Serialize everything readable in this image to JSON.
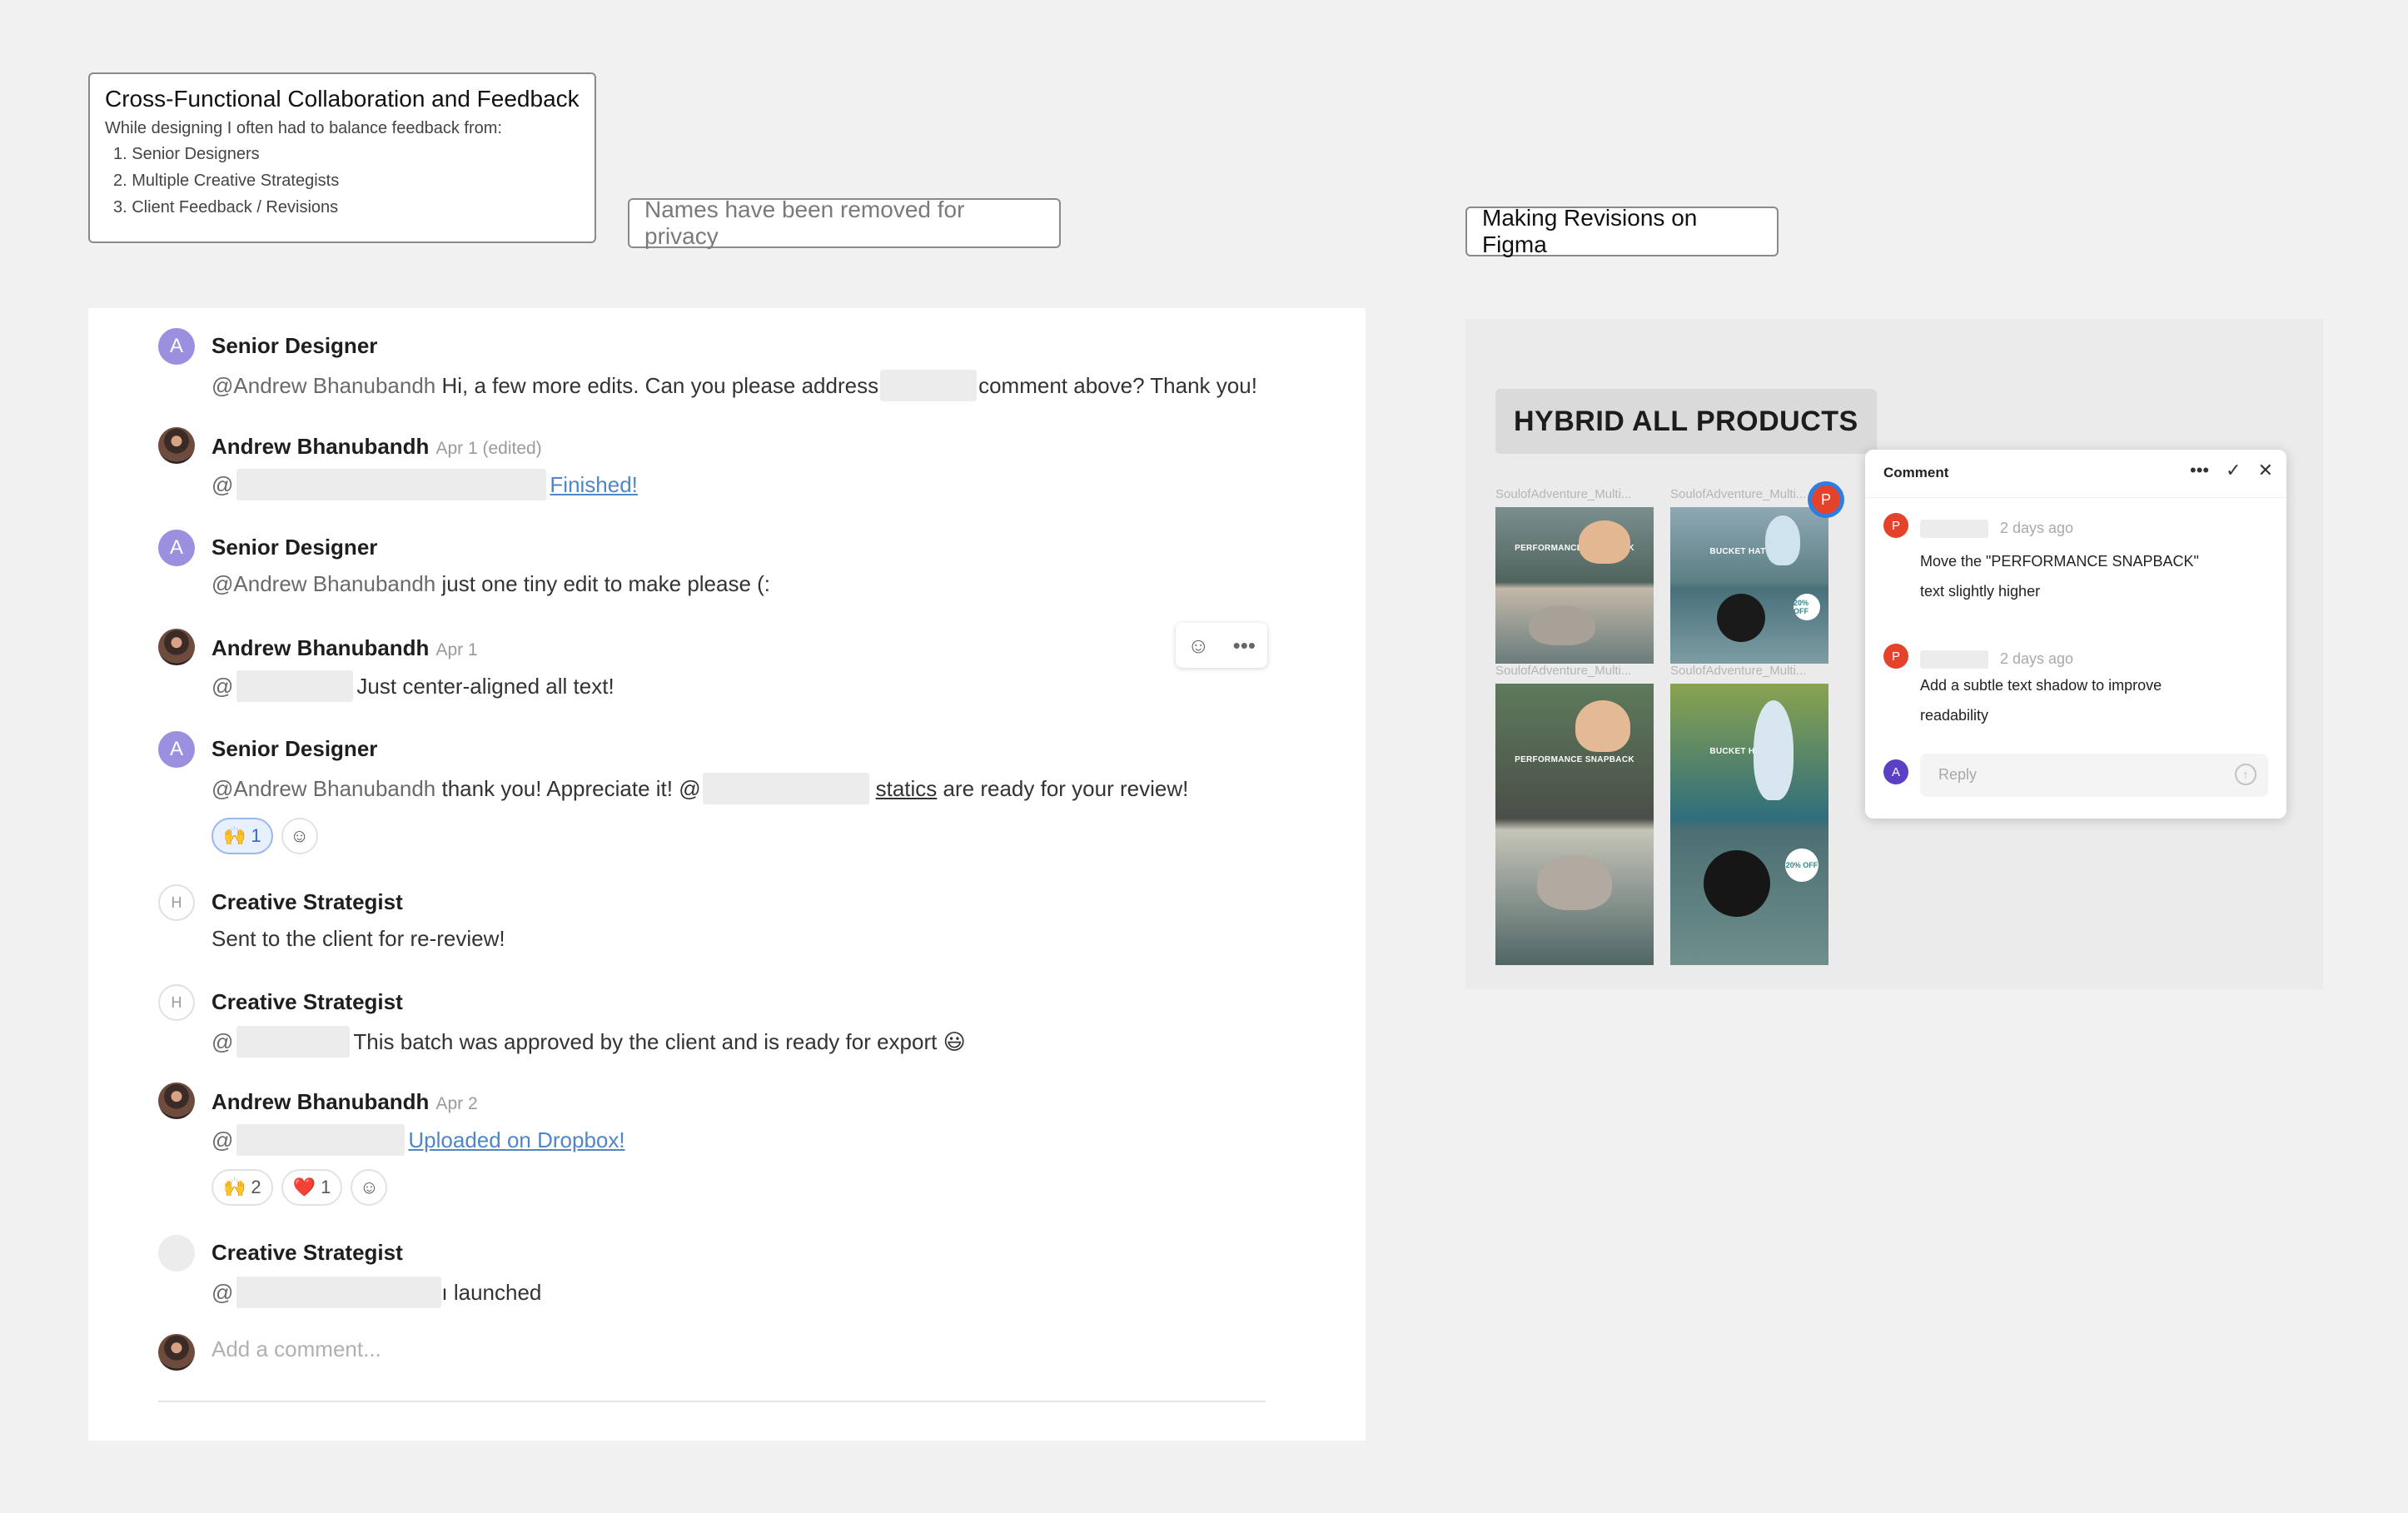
{
  "note_main": {
    "title": "Cross-Functional Collaboration and Feedback",
    "subtitle": "While designing I often had to balance feedback from:",
    "items": [
      "1. Senior Designers",
      "2. Multiple Creative Strategists",
      "3. Client Feedback / Revisions"
    ]
  },
  "privacy_note": "Names have been removed for privacy",
  "figma_label": "Making Revisions on Figma",
  "comments": [
    {
      "author": "Senior Designer",
      "avatar": "A",
      "mention": "@Andrew Bhanubandh",
      "pre": " Hi, a few more edits. Can you please address",
      "post": "comment above? Thank you!"
    },
    {
      "author": "Andrew Bhanubandh",
      "meta": "Apr 1 (edited)",
      "at": "@",
      "link": "Finished!"
    },
    {
      "author": "Senior Designer",
      "avatar": "A",
      "mention": "@Andrew Bhanubandh",
      "text": " just one tiny edit to make please (:"
    },
    {
      "author": "Andrew Bhanubandh",
      "meta": "Apr 1",
      "at": "@",
      "text": "Just center-aligned all text!"
    },
    {
      "author": "Senior Designer",
      "avatar": "A",
      "mention": "@Andrew Bhanubandh",
      "pre": " thank you! Appreciate it! @",
      "link": "statics",
      "post": " are ready for your review!",
      "reaction": "🙌",
      "reaction_count": "1"
    },
    {
      "author": "Creative Strategist",
      "avatar": "H",
      "text": "Sent to the client for re-review!"
    },
    {
      "author": "Creative Strategist",
      "avatar": "H",
      "at": "@",
      "text": "This batch was approved by the client and is ready for export 😃"
    },
    {
      "author": "Andrew Bhanubandh",
      "meta": "Apr 2",
      "at": "@",
      "link": "Uploaded on Dropbox!",
      "reactions": [
        {
          "emoji": "🙌",
          "count": "2"
        },
        {
          "emoji": "❤️",
          "count": "1"
        }
      ]
    },
    {
      "author": "Creative Strategist",
      "at": "@",
      "text": "ı launched"
    }
  ],
  "add_comment_placeholder": "Add a comment...",
  "figma": {
    "frame_title": "HYBRID ALL PRODUCTS",
    "thumb_caption": "SoulofAdventure_Multi...",
    "pin_letter": "P",
    "img_text_snapback": "PERFORMANCE SNAPBACK",
    "img_text_bucket": "BUCKET HAT",
    "discount": "20% OFF",
    "panel": {
      "title": "Comment",
      "items": [
        {
          "avatar": "P",
          "ago": "2 days ago",
          "line1": "Move the \"PERFORMANCE SNAPBACK\"",
          "line2": "text slightly higher"
        },
        {
          "avatar": "P",
          "ago": "2 days ago",
          "line1": "Add a subtle text shadow to improve",
          "line2": "readability"
        }
      ],
      "reply_avatar": "A",
      "reply_placeholder": "Reply"
    }
  },
  "colors": {
    "accent_purple": "#9b90e0",
    "link_blue": "#4f86c6",
    "pin_red": "#e5422b",
    "pin_ring": "#2f7de1"
  }
}
